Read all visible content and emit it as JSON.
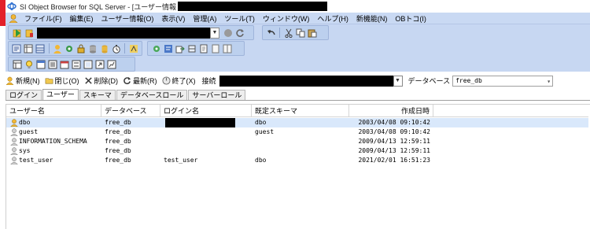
{
  "window": {
    "title": "SI Object Browser for SQL Server - [ユーザー情報"
  },
  "menu": {
    "items": [
      "ファイル(F)",
      "編集(E)",
      "ユーザー情報(O)",
      "表示(V)",
      "管理(A)",
      "ツール(T)",
      "ウィンドウ(W)",
      "ヘルプ(H)",
      "新機能(N)",
      "OBトコ(I)"
    ]
  },
  "actions": {
    "new": "新規(N)",
    "close": "閉じ(O)",
    "delete": "削除(D)",
    "refresh": "最新(R)",
    "exit": "終了(X)",
    "connection_label": "接続",
    "database_label": "データベース",
    "database_value": "free_db"
  },
  "tabs": [
    "ログイン",
    "ユーザー",
    "スキーマ",
    "データベースロール",
    "サーバーロール"
  ],
  "table": {
    "columns": [
      "ユーザー名",
      "データベース",
      "ログイン名",
      "既定スキーマ",
      "作成日時"
    ],
    "rows": [
      {
        "user": "dbo",
        "database": "free_db",
        "login": "",
        "schema": "dbo",
        "created": "2003/04/08 09:10:42"
      },
      {
        "user": "guest",
        "database": "free_db",
        "login": "",
        "schema": "guest",
        "created": "2003/04/08 09:10:42"
      },
      {
        "user": "INFORMATION_SCHEMA",
        "database": "free_db",
        "login": "",
        "schema": "",
        "created": "2009/04/13 12:59:11"
      },
      {
        "user": "sys",
        "database": "free_db",
        "login": "",
        "schema": "",
        "created": "2009/04/13 12:59:11"
      },
      {
        "user": "test_user",
        "database": "free_db",
        "login": "test_user",
        "schema": "dbo",
        "created": "2021/02/01 16:51:23"
      }
    ]
  },
  "colors": {
    "menubar": "#c9d9f3",
    "toolbar": "#bcd0ee",
    "selected_row": "#d9e8fb",
    "accent_red": "#e3202a"
  }
}
